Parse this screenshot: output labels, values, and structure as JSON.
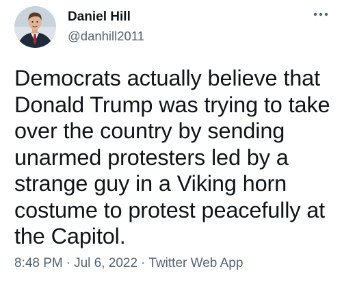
{
  "author": {
    "display_name": "Daniel Hill",
    "handle": "@danhill2011",
    "avatar_icon": "profile-photo"
  },
  "menu": {
    "icon": "more-horizontal-icon"
  },
  "tweet": {
    "lines": [
      "Democrats actually believe that",
      "Donald Trump was trying to take",
      "over the country by sending",
      "unarmed protesters led by a",
      "strange guy in a Viking horn",
      "costume to protest peacefully at",
      "the Capitol."
    ]
  },
  "meta": {
    "time": "8:48 PM",
    "separator": "·",
    "date": "Jul 6, 2022",
    "source": "Twitter Web App"
  },
  "colors": {
    "text_primary": "#0f1419",
    "text_secondary": "#536471",
    "background": "#ffffff"
  }
}
